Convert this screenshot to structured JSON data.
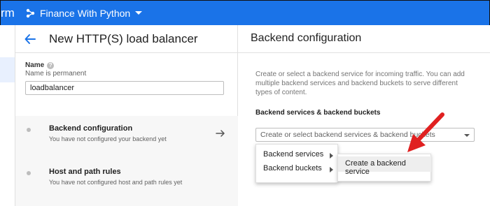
{
  "topbar": {
    "brand_fragment": "rm",
    "project_name": "Finance With Python",
    "colors": {
      "background": "#1a73e8",
      "text": "#ffffff"
    }
  },
  "left_panel": {
    "title": "New HTTP(S) load balancer",
    "name_field": {
      "label": "Name",
      "hint": "Name is permanent",
      "value": "loadbalancer"
    },
    "steps": [
      {
        "title": "Backend configuration",
        "subtitle": "You have not configured your backend yet"
      },
      {
        "title": "Host and path rules",
        "subtitle": "You have not configured host and path rules yet"
      }
    ]
  },
  "right_panel": {
    "title": "Backend configuration",
    "description": "Create or select a backend service for incoming traffic. You can add multiple backend services and backend buckets to serve different types of content.",
    "section_label": "Backend services & backend buckets",
    "select_placeholder": "Create or select backend services & backend buckets",
    "menu": {
      "items": [
        "Backend services",
        "Backend buckets"
      ]
    },
    "submenu": {
      "items": [
        "Create a backend service"
      ]
    }
  },
  "icons": {
    "project": "project-nodes-icon",
    "dropdown": "caret-down-icon",
    "back": "arrow-back-icon",
    "help": "help-icon",
    "next": "arrow-forward-icon",
    "annotation": "red-arrow-icon"
  },
  "annotation_color": "#e02020"
}
